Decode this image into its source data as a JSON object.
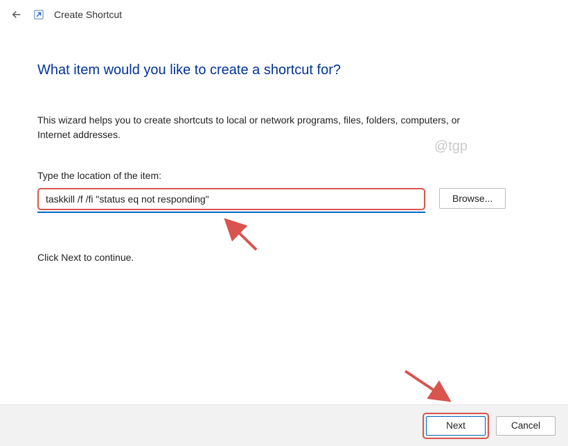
{
  "titlebar": {
    "title": "Create Shortcut"
  },
  "heading": "What item would you like to create a shortcut for?",
  "description": "This wizard helps you to create shortcuts to local or network programs, files, folders, computers, or Internet addresses.",
  "field_label": "Type the location of the item:",
  "location_value": "taskkill /f /fi \"status eq not responding\"",
  "browse_label": "Browse...",
  "continue_text": "Click Next to continue.",
  "watermark": "@tgp",
  "footer": {
    "next_label": "Next",
    "cancel_label": "Cancel"
  },
  "annotation_color": "#d9534f"
}
